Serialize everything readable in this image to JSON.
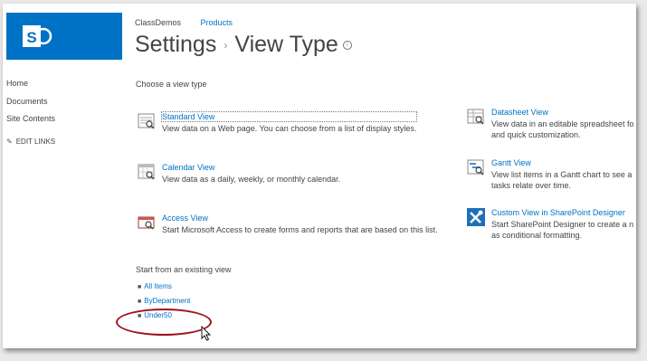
{
  "topnav": {
    "site": "ClassDemos",
    "list": "Products"
  },
  "title": {
    "part1": "Settings",
    "separator": "›",
    "part2": "View Type",
    "info_icon": "i"
  },
  "leftnav": {
    "items": [
      "Home",
      "Documents",
      "Site Contents"
    ],
    "edit_links": "EDIT LINKS"
  },
  "choose_label": "Choose a view type",
  "view_types": [
    {
      "title": "Standard View",
      "desc1": "View data on a Web page. You can choose from a list of display styles.",
      "desc2": "",
      "icon": "standard-view-icon"
    },
    {
      "title": "Calendar View",
      "desc1": "View data as a daily, weekly, or monthly calendar.",
      "desc2": "",
      "icon": "calendar-view-icon"
    },
    {
      "title": "Access View",
      "desc1": "Start Microsoft Access to create forms and reports that are based on this list.",
      "desc2": "",
      "icon": "access-view-icon"
    },
    {
      "title": "Datasheet View",
      "desc1": "View data in an editable spreadsheet fo",
      "desc2": "and quick customization.",
      "icon": "datasheet-view-icon"
    },
    {
      "title": "Gantt View",
      "desc1": "View list items in a Gantt chart to see a",
      "desc2": "tasks relate over time.",
      "icon": "gantt-view-icon"
    },
    {
      "title": "Custom View in SharePoint Designer",
      "desc1": "Start SharePoint Designer to create a n",
      "desc2": "as conditional formatting.",
      "icon": "sharepoint-designer-icon"
    }
  ],
  "existing": {
    "label": "Start from an existing view",
    "items": [
      "All Items",
      "ByDepartment",
      "Under50"
    ]
  },
  "colors": {
    "brand": "#0072c6",
    "highlight": "#a0121a"
  }
}
